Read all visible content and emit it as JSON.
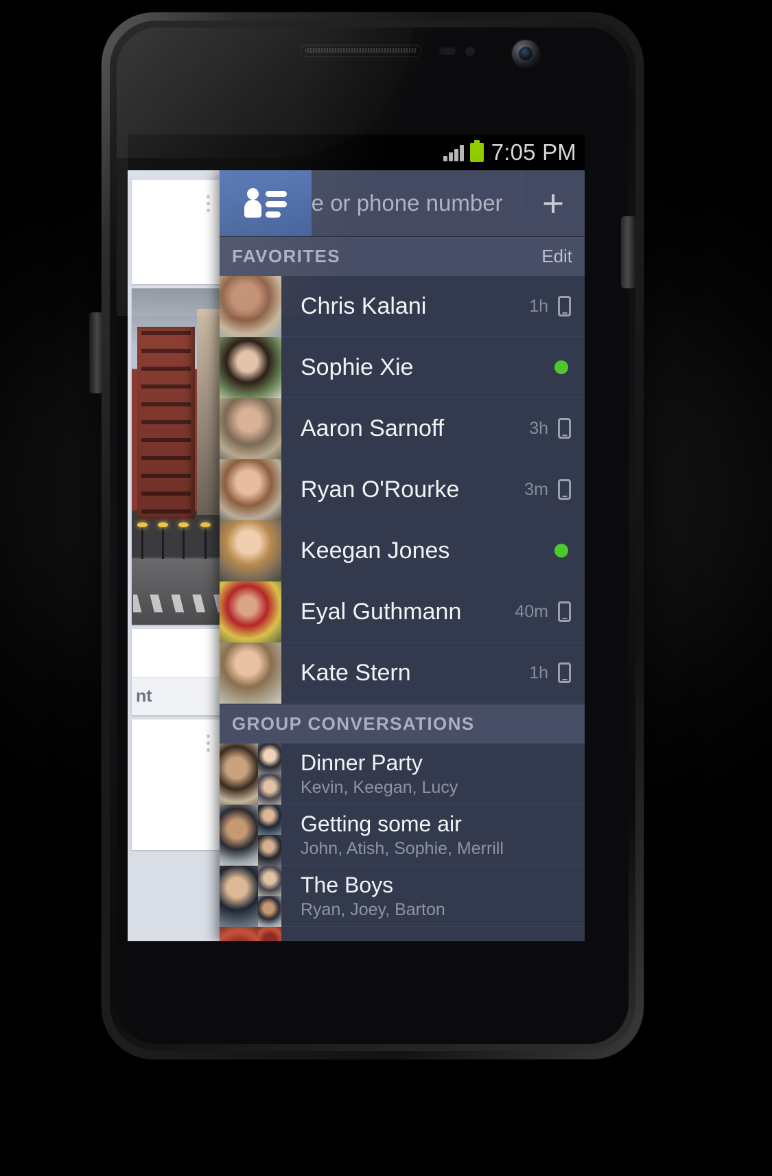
{
  "statusbar": {
    "time": "7:05 PM",
    "signal_icon": "signal-bars-icon",
    "battery_icon": "battery-full-icon"
  },
  "header": {
    "contacts_button_icon": "contacts-list-icon",
    "search_placeholder": "Name or phone number",
    "search_value": "",
    "search_icon": "search-icon",
    "add_button_label": "+"
  },
  "sections": {
    "favorites": {
      "title": "FAVORITES",
      "action": "Edit"
    },
    "groups": {
      "title": "GROUP CONVERSATIONS"
    }
  },
  "favorites": [
    {
      "name": "Chris Kalani",
      "time": "1h",
      "status": "mobile",
      "avatar": "pA"
    },
    {
      "name": "Sophie Xie",
      "time": "",
      "status": "online",
      "avatar": "pB"
    },
    {
      "name": "Aaron Sarnoff",
      "time": "3h",
      "status": "mobile",
      "avatar": "pC"
    },
    {
      "name": "Ryan O'Rourke",
      "time": "3m",
      "status": "mobile",
      "avatar": "pD"
    },
    {
      "name": "Keegan Jones",
      "time": "",
      "status": "online",
      "avatar": "pE"
    },
    {
      "name": "Eyal Guthmann",
      "time": "40m",
      "status": "mobile",
      "avatar": "pF"
    },
    {
      "name": "Kate Stern",
      "time": "1h",
      "status": "mobile",
      "avatar": "pG"
    }
  ],
  "groups": [
    {
      "title": "Dinner Party",
      "members": "Kevin, Keegan, Lucy",
      "a1": "pH",
      "a2": "pI",
      "a3": "pJ"
    },
    {
      "title": "Getting some air",
      "members": "John, Atish, Sophie, Merrill",
      "a1": "pK",
      "a2": "pL",
      "a3": "pM"
    },
    {
      "title": "The Boys",
      "members": "Ryan, Joey, Barton",
      "a1": "pL",
      "a2": "pJ",
      "a3": "pK"
    }
  ],
  "newsfeed": {
    "comment_label": "nt",
    "menu_icon": "overflow-menu-icon",
    "photo_alt": "city-street-photo"
  },
  "colors": {
    "brand_blue": "#4a6ba8",
    "panel_bg": "#343a4d",
    "section_bg": "#474e65",
    "online_green": "#4ec92c",
    "battery_green": "#8fcc00"
  }
}
